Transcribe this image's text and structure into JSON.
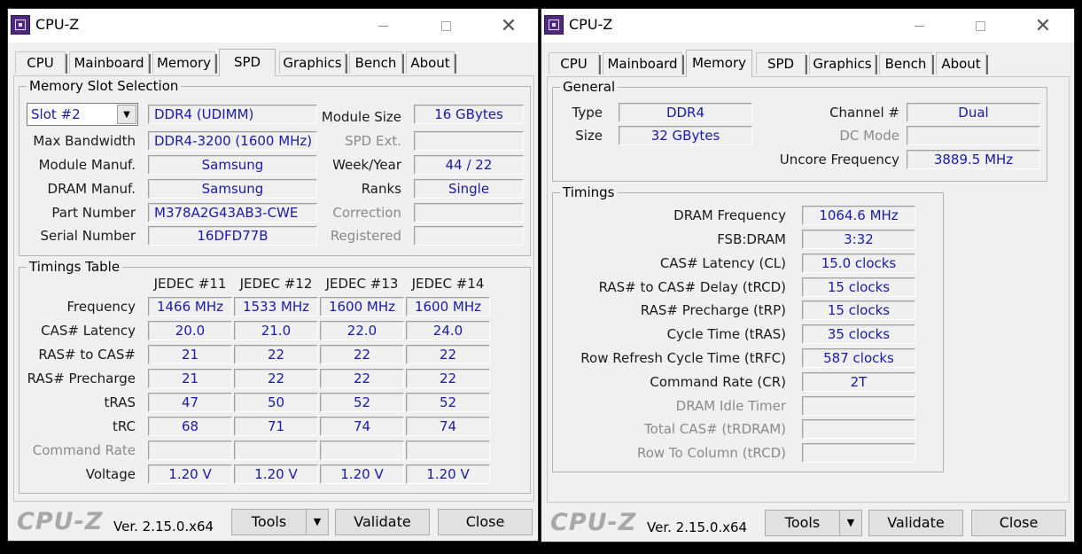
{
  "app": {
    "title": "CPU-Z",
    "logo": "CPU-Z",
    "version": "Ver. 2.15.0.x64"
  },
  "tabs": [
    "CPU",
    "Mainboard",
    "Memory",
    "SPD",
    "Graphics",
    "Bench",
    "About"
  ],
  "buttons": {
    "tools": "Tools",
    "validate": "Validate",
    "close": "Close"
  },
  "spd": {
    "slot_group": "Memory Slot Selection",
    "slot_value": "Slot #2",
    "module_type": "DDR4 (UDIMM)",
    "labels": {
      "max_bandwidth": "Max Bandwidth",
      "module_manuf": "Module Manuf.",
      "dram_manuf": "DRAM Manuf.",
      "part_number": "Part Number",
      "serial_number": "Serial Number",
      "module_size": "Module Size",
      "spd_ext": "SPD Ext.",
      "week_year": "Week/Year",
      "ranks": "Ranks",
      "correction": "Correction",
      "registered": "Registered"
    },
    "values": {
      "max_bandwidth": "DDR4-3200 (1600 MHz)",
      "module_manuf": "Samsung",
      "dram_manuf": "Samsung",
      "part_number": "M378A2G43AB3-CWE",
      "serial_number": "16DFD77B",
      "module_size": "16 GBytes",
      "spd_ext": "",
      "week_year": "44 / 22",
      "ranks": "Single",
      "correction": "",
      "registered": ""
    },
    "timings_group": "Timings Table",
    "columns": [
      "JEDEC #11",
      "JEDEC #12",
      "JEDEC #13",
      "JEDEC #14"
    ],
    "rows": [
      {
        "label": "Frequency",
        "values": [
          "1466 MHz",
          "1533 MHz",
          "1600 MHz",
          "1600 MHz"
        ],
        "disabled": false
      },
      {
        "label": "CAS# Latency",
        "values": [
          "20.0",
          "21.0",
          "22.0",
          "24.0"
        ],
        "disabled": false
      },
      {
        "label": "RAS# to CAS#",
        "values": [
          "21",
          "22",
          "22",
          "22"
        ],
        "disabled": false
      },
      {
        "label": "RAS# Precharge",
        "values": [
          "21",
          "22",
          "22",
          "22"
        ],
        "disabled": false
      },
      {
        "label": "tRAS",
        "values": [
          "47",
          "50",
          "52",
          "52"
        ],
        "disabled": false
      },
      {
        "label": "tRC",
        "values": [
          "68",
          "71",
          "74",
          "74"
        ],
        "disabled": false
      },
      {
        "label": "Command Rate",
        "values": [
          "",
          "",
          "",
          ""
        ],
        "disabled": true
      },
      {
        "label": "Voltage",
        "values": [
          "1.20 V",
          "1.20 V",
          "1.20 V",
          "1.20 V"
        ],
        "disabled": false
      }
    ]
  },
  "memory": {
    "general_group": "General",
    "labels": {
      "type": "Type",
      "size": "Size",
      "channel": "Channel #",
      "dc_mode": "DC Mode",
      "uncore": "Uncore Frequency"
    },
    "values": {
      "type": "DDR4",
      "size": "32 GBytes",
      "channel": "Dual",
      "dc_mode": "",
      "uncore": "3889.5 MHz"
    },
    "timings_group": "Timings",
    "timings": [
      {
        "label": "DRAM Frequency",
        "value": "1064.6 MHz",
        "disabled": false
      },
      {
        "label": "FSB:DRAM",
        "value": "3:32",
        "disabled": false
      },
      {
        "label": "CAS# Latency (CL)",
        "value": "15.0 clocks",
        "disabled": false
      },
      {
        "label": "RAS# to CAS# Delay (tRCD)",
        "value": "15 clocks",
        "disabled": false
      },
      {
        "label": "RAS# Precharge (tRP)",
        "value": "15 clocks",
        "disabled": false
      },
      {
        "label": "Cycle Time (tRAS)",
        "value": "35 clocks",
        "disabled": false
      },
      {
        "label": "Row Refresh Cycle Time (tRFC)",
        "value": "587 clocks",
        "disabled": false
      },
      {
        "label": "Command Rate (CR)",
        "value": "2T",
        "disabled": false
      },
      {
        "label": "DRAM Idle Timer",
        "value": "",
        "disabled": true
      },
      {
        "label": "Total CAS# (tRDRAM)",
        "value": "",
        "disabled": true
      },
      {
        "label": "Row To Column (tRCD)",
        "value": "",
        "disabled": true
      }
    ]
  }
}
